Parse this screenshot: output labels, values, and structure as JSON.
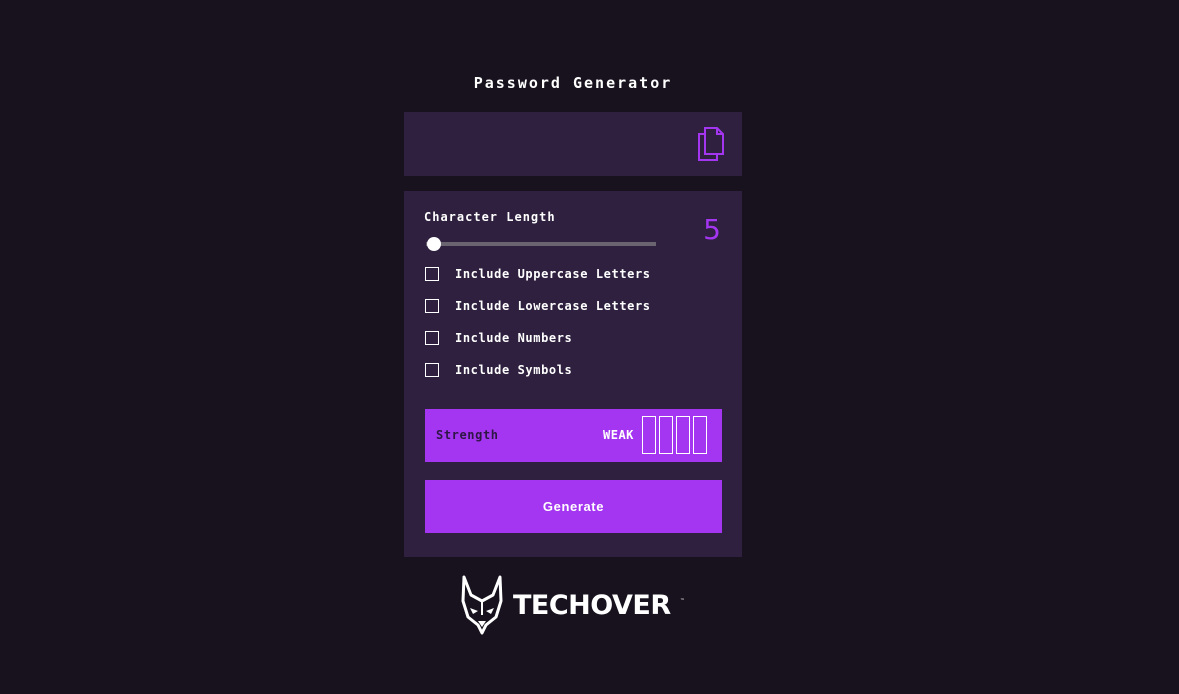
{
  "app": {
    "title": "Password Generator"
  },
  "output": {
    "password": "",
    "copy_icon": "copy-icon"
  },
  "length": {
    "label": "Character Length",
    "value": "5",
    "slider_fraction": 0
  },
  "options": [
    {
      "label": "Include Uppercase Letters",
      "checked": false
    },
    {
      "label": "Include Lowercase Letters",
      "checked": false
    },
    {
      "label": "Include Numbers",
      "checked": false
    },
    {
      "label": "Include Symbols",
      "checked": false
    }
  ],
  "strength": {
    "label": "Strength",
    "value": "WEAK",
    "bars_filled": 0,
    "bars_total": 4
  },
  "generate": {
    "label": "Generate"
  },
  "logo": {
    "text": "TECHOVER",
    "mark": "™"
  },
  "colors": {
    "accent": "#a435f0",
    "background": "#17121e",
    "panel": "#2e203e"
  }
}
